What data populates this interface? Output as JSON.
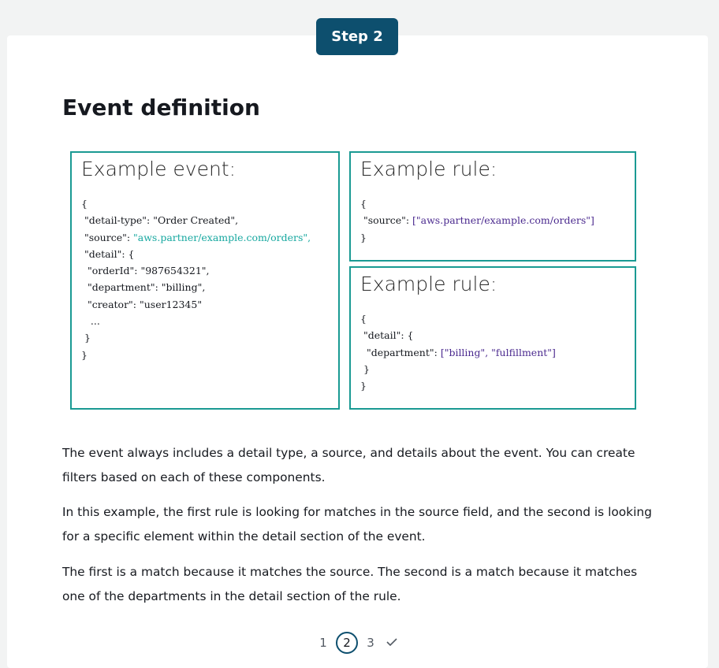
{
  "step_badge": "Step 2",
  "title": "Event definition",
  "event_box": {
    "title": "Example event:",
    "lines": [
      {
        "text": "{"
      },
      {
        "text": " \"detail-type\": \"Order Created\","
      },
      {
        "text": " \"source\": ",
        "value": "\"aws.partner/example.com/orders\",",
        "value_color": "teal"
      },
      {
        "text": " \"detail\": {"
      },
      {
        "text": "  \"orderId\": \"987654321\","
      },
      {
        "text": "  \"department\": \"billing\","
      },
      {
        "text": "  \"creator\": \"user12345\""
      },
      {
        "text": "   ..."
      },
      {
        "text": " }"
      },
      {
        "text": "}"
      }
    ]
  },
  "rule1_box": {
    "title": "Example rule:",
    "lines": [
      {
        "text": "{"
      },
      {
        "text": " \"source\": ",
        "value": "[\"aws.partner/example.com/orders\"]",
        "value_color": "purple"
      },
      {
        "text": "}"
      }
    ]
  },
  "rule2_box": {
    "title": "Example rule:",
    "lines": [
      {
        "text": "{"
      },
      {
        "text": " \"detail\": {"
      },
      {
        "text": "  \"department\": ",
        "value": "[\"billing\", \"fulfillment\"]",
        "value_color": "purple"
      },
      {
        "text": " }"
      },
      {
        "text": "}"
      }
    ]
  },
  "paragraphs": [
    "The event always includes a detail type, a source, and details about the event. You can create filters based on each of these components.",
    "In this example, the first rule is looking for matches in the source field, and the second is looking for a specific element within the detail section of the event.",
    "The first is a match because it matches the source. The second is a match because it matches one of the departments in the detail section of the rule."
  ],
  "pagination": {
    "pages": [
      "1",
      "2",
      "3"
    ],
    "current": "2",
    "complete_icon": "check-icon"
  },
  "colors": {
    "badge": "#0d4f6e",
    "box_border": "#1a9a93",
    "teal_value": "#17a8a0",
    "purple_value": "#4b2a8f"
  }
}
